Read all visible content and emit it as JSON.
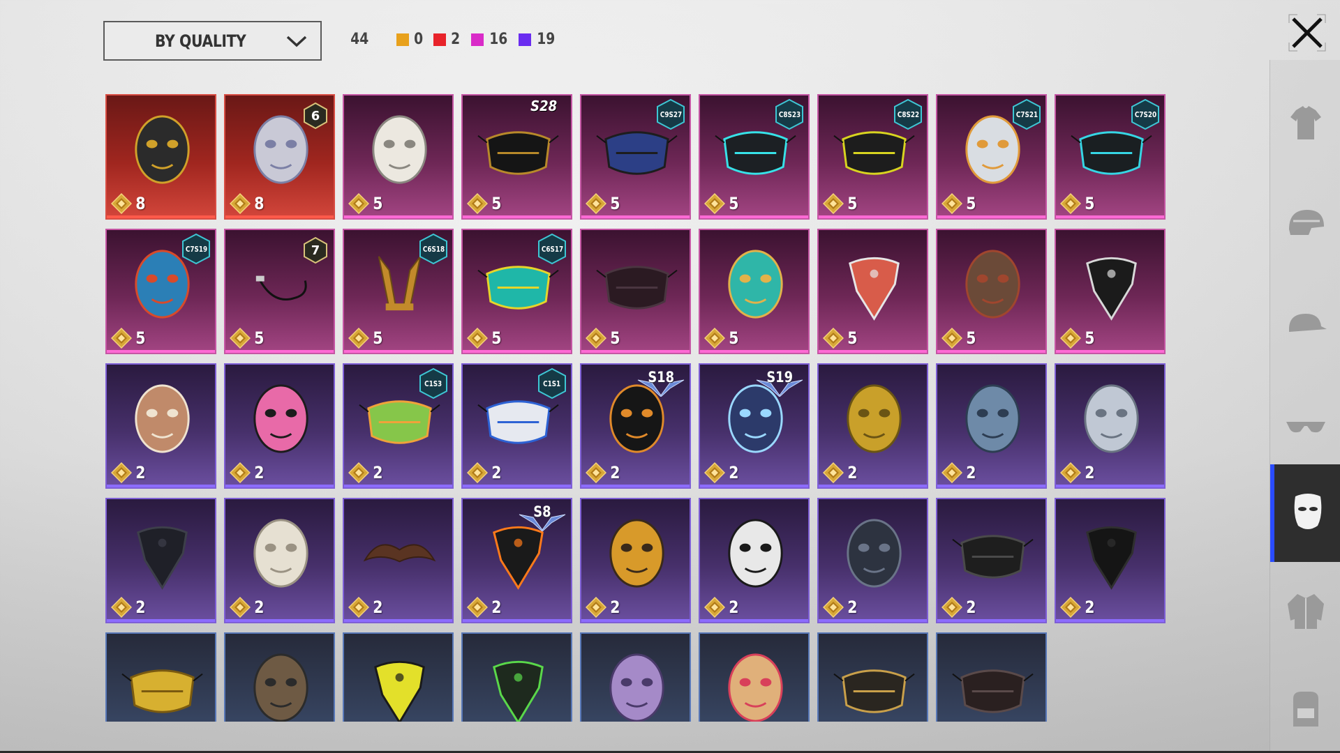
{
  "toolbar": {
    "sort_label": "BY QUALITY",
    "sort_icon": "chevron-down-icon",
    "total_count": "44",
    "quality_counts": [
      {
        "color": "#e8a11c",
        "count": "0"
      },
      {
        "color": "#e8232a",
        "count": "2"
      },
      {
        "color": "#d92bc8",
        "count": "16"
      },
      {
        "color": "#6a2cf0",
        "count": "19"
      }
    ],
    "close_icon": "close-icon"
  },
  "items": [
    {
      "quality": "red",
      "cost": "8",
      "badge": "",
      "art": "steel-knight-mask"
    },
    {
      "quality": "red",
      "cost": "8",
      "badge_rank": "6",
      "art": "plague-beak-mask"
    },
    {
      "quality": "pink",
      "cost": "5",
      "art": "crying-cat-mask"
    },
    {
      "quality": "pink",
      "cost": "5",
      "badge_season": "S28",
      "art": "black-dragon-face-mask"
    },
    {
      "quality": "pink",
      "cost": "5",
      "badge_hex": "C9S27",
      "art": "blue-respirator"
    },
    {
      "quality": "pink",
      "cost": "5",
      "badge_hex": "C8S23",
      "art": "cyan-tech-mask"
    },
    {
      "quality": "pink",
      "cost": "5",
      "badge_hex": "C8S22",
      "art": "black-ring-mask"
    },
    {
      "quality": "pink",
      "cost": "5",
      "badge_hex": "C7S21",
      "art": "white-mech-mask"
    },
    {
      "quality": "pink",
      "cost": "5",
      "badge_hex": "C7S20",
      "art": "black-cyan-mask"
    },
    {
      "quality": "pink",
      "cost": "5",
      "badge_hex": "C7S19",
      "art": "tribal-mask"
    },
    {
      "quality": "pink",
      "cost": "5",
      "badge_rank": "7",
      "art": "earpiece"
    },
    {
      "quality": "pink",
      "cost": "5",
      "badge_hex": "C6S18",
      "art": "golden-horns"
    },
    {
      "quality": "pink",
      "cost": "5",
      "badge_hex": "C6S17",
      "art": "graffiti-face-mask"
    },
    {
      "quality": "pink",
      "cost": "5",
      "art": "dark-muzzle"
    },
    {
      "quality": "pink",
      "cost": "5",
      "art": "lion-dance-mask"
    },
    {
      "quality": "pink",
      "cost": "5",
      "art": "skull-bandana-red"
    },
    {
      "quality": "pink",
      "cost": "5",
      "art": "leather-beak-mask"
    },
    {
      "quality": "pink",
      "cost": "5",
      "art": "skull-bandana-black"
    },
    {
      "quality": "purple",
      "cost": "2",
      "art": "mammoth-mask"
    },
    {
      "quality": "purple",
      "cost": "2",
      "art": "pink-monkey-mask"
    },
    {
      "quality": "purple",
      "cost": "2",
      "badge_hex": "C1S3",
      "art": "green-cross-face-mask"
    },
    {
      "quality": "purple",
      "cost": "2",
      "badge_hex": "C1S1",
      "art": "blue-white-face-mask"
    },
    {
      "quality": "purple",
      "cost": "2",
      "badge_wing": "S18",
      "art": "heartbeat-mask"
    },
    {
      "quality": "purple",
      "cost": "2",
      "badge_wing": "S19",
      "art": "visor-mask"
    },
    {
      "quality": "purple",
      "cost": "2",
      "art": "gold-helmet-mask"
    },
    {
      "quality": "purple",
      "cost": "2",
      "art": "blue-steel-mask"
    },
    {
      "quality": "purple",
      "cost": "2",
      "art": "silver-steel-mask"
    },
    {
      "quality": "purple",
      "cost": "2",
      "art": "black-bandana"
    },
    {
      "quality": "purple",
      "cost": "2",
      "art": "mummy-mask"
    },
    {
      "quality": "purple",
      "cost": "2",
      "art": "mustache"
    },
    {
      "quality": "purple",
      "cost": "2",
      "badge_wing": "S8",
      "art": "flame-bandana"
    },
    {
      "quality": "purple",
      "cost": "2",
      "art": "studded-gold-mask"
    },
    {
      "quality": "purple",
      "cost": "2",
      "art": "white-teeth-mask"
    },
    {
      "quality": "purple",
      "cost": "2",
      "art": "dark-skull-mask"
    },
    {
      "quality": "purple",
      "cost": "2",
      "art": "riot-muzzle"
    },
    {
      "quality": "purple",
      "cost": "2",
      "art": "plain-black-bandana"
    },
    {
      "quality": "blue",
      "cost": "",
      "art": "gold-sequin-mask"
    },
    {
      "quality": "blue",
      "cost": "",
      "art": "rusty-hockey-mask"
    },
    {
      "quality": "blue",
      "cost": "",
      "art": "yellow-dot-bandana"
    },
    {
      "quality": "blue",
      "cost": "",
      "art": "green-web-bandana"
    },
    {
      "quality": "blue",
      "cost": "",
      "art": "purple-theater-mask"
    },
    {
      "quality": "blue",
      "cost": "",
      "art": "red-theater-mask"
    },
    {
      "quality": "blue",
      "cost": "",
      "art": "gold-pattern-mask"
    },
    {
      "quality": "blue",
      "cost": "",
      "art": "gas-respirator"
    }
  ],
  "sidebar": [
    {
      "name": "outfit-tab",
      "icon": "shirt-icon",
      "active": false
    },
    {
      "name": "helmet-tab",
      "icon": "helmet-icon",
      "active": false
    },
    {
      "name": "cap-tab",
      "icon": "cap-icon",
      "active": false
    },
    {
      "name": "glasses-tab",
      "icon": "glasses-icon",
      "active": false
    },
    {
      "name": "mask-tab",
      "icon": "mask-icon",
      "active": true
    },
    {
      "name": "jacket-tab",
      "icon": "jacket-icon",
      "active": false
    },
    {
      "name": "backpack-tab",
      "icon": "backpack-icon",
      "active": false
    }
  ]
}
